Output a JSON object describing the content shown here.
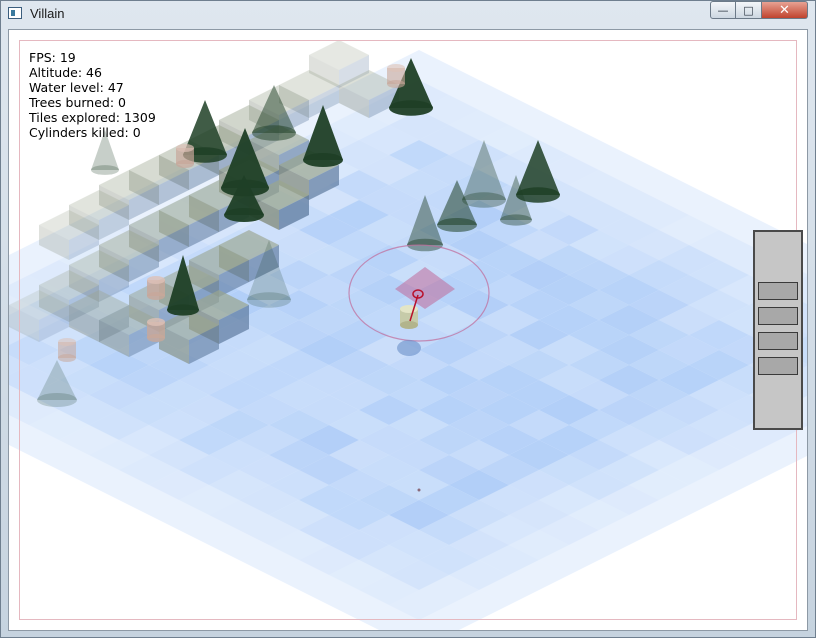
{
  "window": {
    "title": "Villain",
    "minimize_glyph": "—",
    "maximize_glyph": "□",
    "close_glyph": "✕"
  },
  "hud": {
    "fps": "FPS: 19",
    "altitude": "Altitude: 46",
    "water_level": "Water level: 47",
    "trees_burned": "Trees burned: 0",
    "tiles_explored": "Tiles explored: 1309",
    "cylinders_killed": "Cylinders killed: 0"
  },
  "colors": {
    "water": "#8db8f5",
    "land": "#8d9a84",
    "tree": "#1f3f26",
    "cylinder": "#c8a79a",
    "target": "#c06a99"
  },
  "side_panel": {
    "slots": 4
  }
}
